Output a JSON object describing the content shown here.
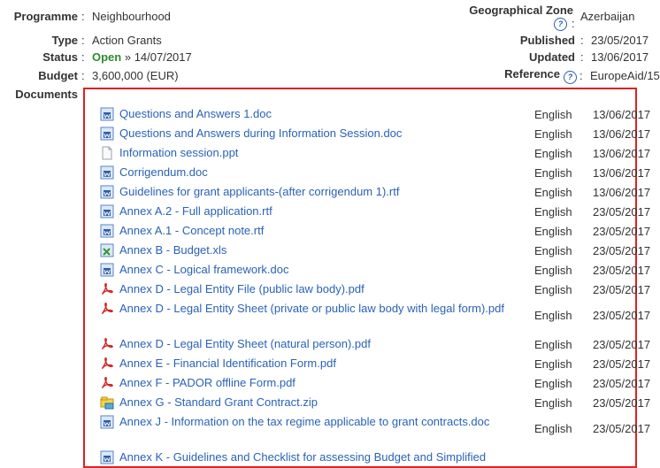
{
  "info": {
    "programme": {
      "label": "Programme",
      "value": "Neighbourhood"
    },
    "type": {
      "label": "Type",
      "value": "Action Grants"
    },
    "status": {
      "label": "Status",
      "value_strong": "Open",
      "value_rest": " » 14/07/2017"
    },
    "budget": {
      "label": "Budget",
      "value": "3,600,000 (EUR)"
    },
    "documents_label": "Documents",
    "geo_zone": {
      "label": "Geographical Zone",
      "value": "Azerbaijan"
    },
    "published": {
      "label": "Published",
      "value": "23/05/2017"
    },
    "updated": {
      "label": "Updated",
      "value": "13/06/2017"
    },
    "reference": {
      "label": "Reference",
      "value": "EuropeAid/15"
    },
    "help_glyph": "?",
    "colon": ":"
  },
  "documents": [
    {
      "name": "Questions and Answers 1.doc",
      "icon": "word-doc-icon",
      "lang": "English",
      "date": "13/06/2017"
    },
    {
      "name": "Questions and Answers during Information Session.doc",
      "icon": "word-doc-icon",
      "lang": "English",
      "date": "13/06/2017"
    },
    {
      "name": "Information session.ppt",
      "icon": "generic-file-icon",
      "lang": "English",
      "date": "13/06/2017"
    },
    {
      "name": "Corrigendum.doc",
      "icon": "word-doc-icon",
      "lang": "English",
      "date": "13/06/2017"
    },
    {
      "name": "Guidelines for grant applicants-(after corrigendum 1).rtf",
      "icon": "word-doc-icon",
      "lang": "English",
      "date": "13/06/2017"
    },
    {
      "name": "Annex A.2 - Full application.rtf",
      "icon": "word-doc-icon",
      "lang": "English",
      "date": "23/05/2017"
    },
    {
      "name": "Annex A.1 - Concept note.rtf",
      "icon": "word-doc-icon",
      "lang": "English",
      "date": "23/05/2017"
    },
    {
      "name": "Annex B - Budget.xls",
      "icon": "excel-icon",
      "lang": "English",
      "date": "23/05/2017"
    },
    {
      "name": "Annex C - Logical framework.doc",
      "icon": "word-doc-icon",
      "lang": "English",
      "date": "23/05/2017"
    },
    {
      "name": "Annex D - Legal Entity File (public law body).pdf",
      "icon": "pdf-icon",
      "lang": "English",
      "date": "23/05/2017"
    },
    {
      "name": "Annex D - Legal Entity Sheet (private or public law body with legal form).pdf",
      "icon": "pdf-icon",
      "lang": "English",
      "date": "23/05/2017"
    },
    {
      "name": "Annex D - Legal Entity Sheet (natural person).pdf",
      "icon": "pdf-icon",
      "lang": "English",
      "date": "23/05/2017"
    },
    {
      "name": "Annex E - Financial Identification Form.pdf",
      "icon": "pdf-icon",
      "lang": "English",
      "date": "23/05/2017"
    },
    {
      "name": "Annex F - PADOR offline Form.pdf",
      "icon": "pdf-icon",
      "lang": "English",
      "date": "23/05/2017"
    },
    {
      "name": "Annex G - Standard Grant Contract.zip",
      "icon": "zip-icon",
      "lang": "English",
      "date": "23/05/2017"
    },
    {
      "name": "Annex J - Information on the tax regime applicable to grant contracts.doc",
      "icon": "word-doc-icon",
      "lang": "English",
      "date": "23/05/2017"
    },
    {
      "name": "Annex K - Guidelines and Checklist for assessing Budget and Simplified",
      "icon": "word-doc-icon",
      "lang": "",
      "date": ""
    }
  ]
}
